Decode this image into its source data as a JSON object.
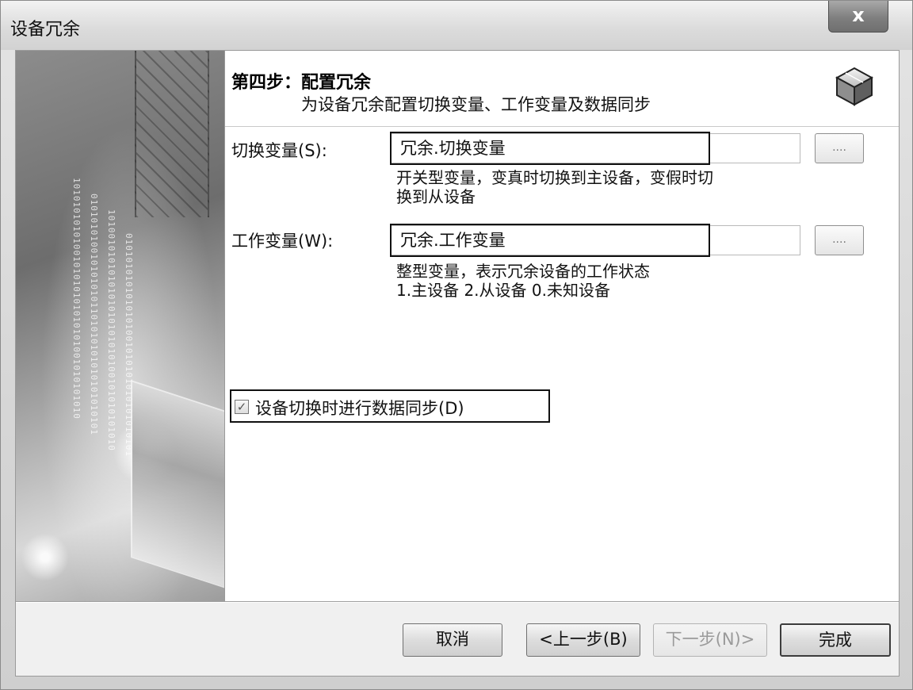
{
  "window": {
    "title": "设备冗余",
    "close_label": "x"
  },
  "header": {
    "step_title": "第四步：配置冗余",
    "step_description": "为设备冗余配置切换变量、工作变量及数据同步",
    "icon": "cube-icon"
  },
  "switch_var": {
    "label": "切换变量(S):",
    "value": "冗余.切换变量",
    "browse_label": "....",
    "hint": "开关型变量，变真时切换到主设备，变假时切\n换到从设备"
  },
  "work_var": {
    "label": "工作变量(W):",
    "value": "冗余.工作变量",
    "browse_label": "....",
    "hint": "整型变量，表示冗余设备的工作状态\n1.主设备 2.从设备 0.未知设备"
  },
  "sync": {
    "label": "设备切换时进行数据同步(D)",
    "checked": true,
    "check_glyph": "✓"
  },
  "buttons": {
    "cancel": "取消",
    "back": "<上一步(B)",
    "next": "下一步(N)>",
    "finish": "完成"
  }
}
